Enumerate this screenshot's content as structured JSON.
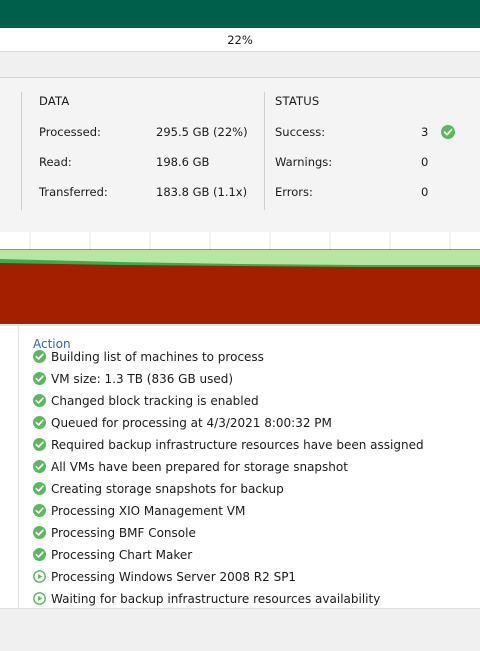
{
  "progress": {
    "percent_label": "22%",
    "fraction": 0.22
  },
  "stats": {
    "data_title": "DATA",
    "status_title": "STATUS",
    "data_rows": [
      {
        "label": "Processed:",
        "value": "295.5 GB (22%)"
      },
      {
        "label": "Read:",
        "value": "198.6 GB"
      },
      {
        "label": "Transferred:",
        "value": "183.8 GB (1.1x)"
      }
    ],
    "status_rows": [
      {
        "label": "Success:",
        "value": "3",
        "icon": "success-check-icon"
      },
      {
        "label": "Warnings:",
        "value": "0"
      },
      {
        "label": "Errors:",
        "value": "0"
      }
    ]
  },
  "colors": {
    "top_bar": "#005f4b",
    "chart_light_green": "#b8e6a0",
    "chart_green": "#2db34a",
    "chart_red": "#a31f00",
    "success": "#5cb85c",
    "link_blue": "#2a6aa5"
  },
  "log": {
    "header": "Action",
    "items": [
      {
        "text": "Building list of machines to process",
        "status": "success"
      },
      {
        "text": "VM size: 1.3 TB (836 GB used)",
        "status": "success"
      },
      {
        "text": "Changed block tracking is enabled",
        "status": "success"
      },
      {
        "text": "Queued for processing at 4/3/2021 8:00:32 PM",
        "status": "success"
      },
      {
        "text": "Required backup infrastructure resources have been assigned",
        "status": "success"
      },
      {
        "text": "All VMs have been prepared for storage snapshot",
        "status": "success"
      },
      {
        "text": "Creating storage snapshots for backup",
        "status": "success"
      },
      {
        "text": "Processing XIO Management VM",
        "status": "success"
      },
      {
        "text": "Processing BMF Console",
        "status": "success"
      },
      {
        "text": "Processing Chart Maker",
        "status": "success"
      },
      {
        "text": "Processing Windows Server 2008 R2 SP1",
        "status": "running"
      },
      {
        "text": "Waiting for backup infrastructure resources availability",
        "status": "running"
      }
    ]
  }
}
